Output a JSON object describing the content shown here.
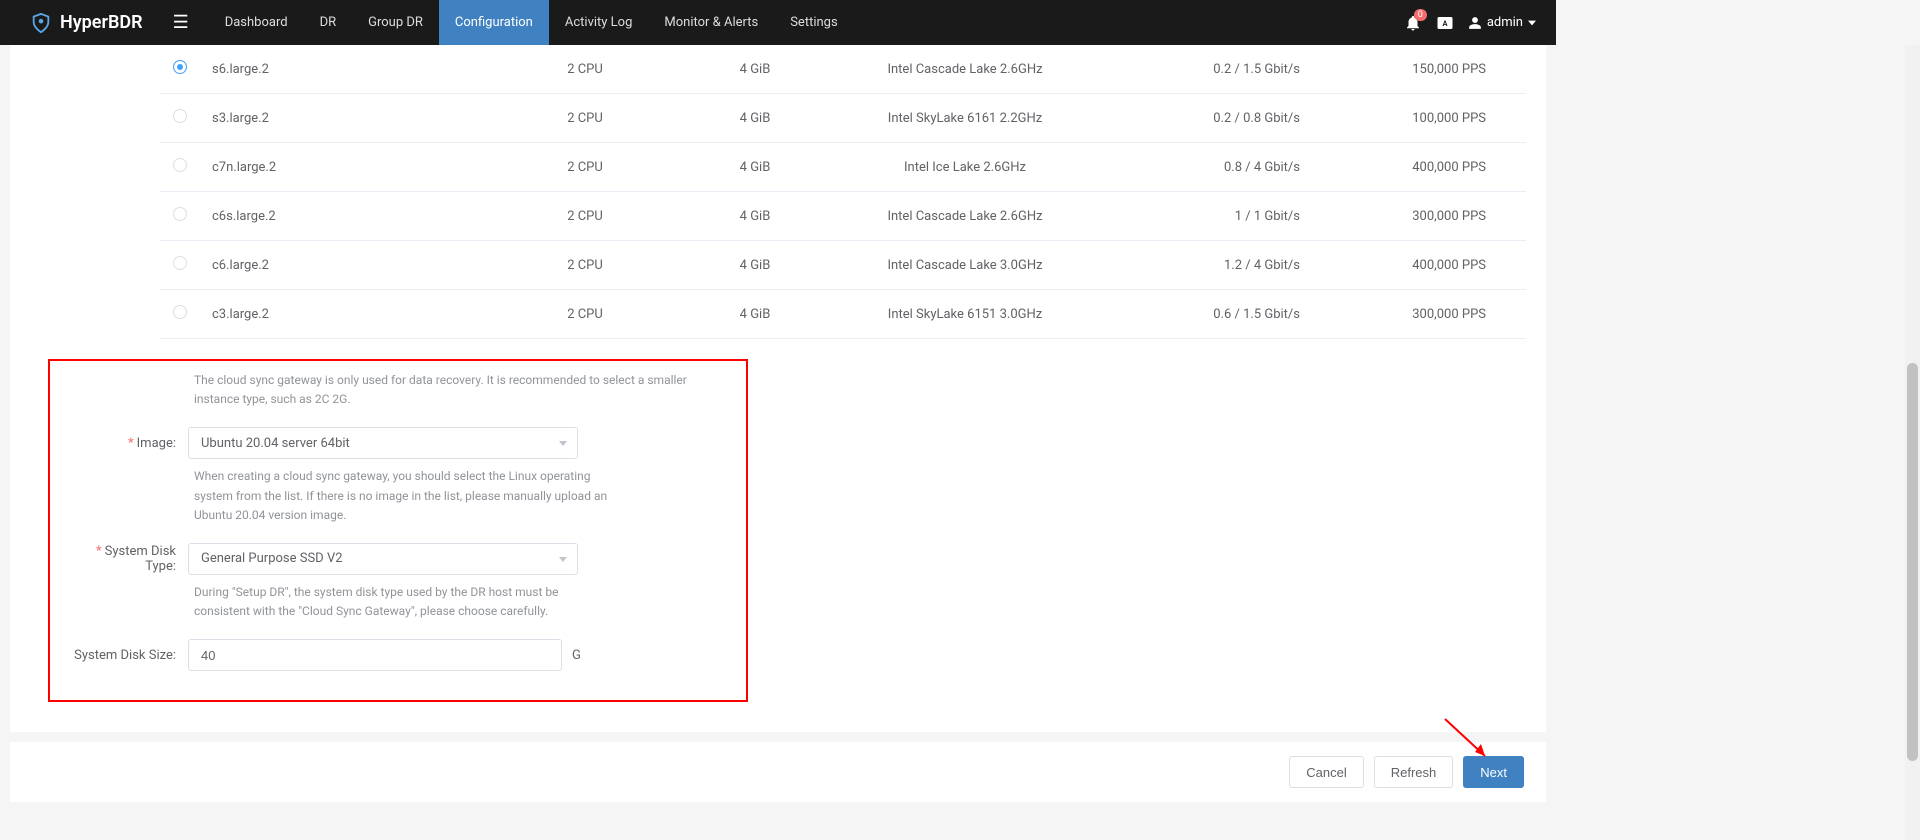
{
  "brand": {
    "name": "HyperBDR"
  },
  "nav": {
    "items": [
      "Dashboard",
      "DR",
      "Group DR",
      "Configuration",
      "Activity Log",
      "Monitor & Alerts",
      "Settings"
    ],
    "activeIndex": 3
  },
  "topbarRight": {
    "notificationCount": "0",
    "user": "admin"
  },
  "instanceTable": {
    "rows": [
      {
        "name": "s6.large.2",
        "cpu": "2 CPU",
        "mem": "4 GiB",
        "cpuModel": "Intel Cascade Lake 2.6GHz",
        "bandwidth": "0.2 / 1.5 Gbit/s",
        "pps": "150,000 PPS",
        "selected": true
      },
      {
        "name": "s3.large.2",
        "cpu": "2 CPU",
        "mem": "4 GiB",
        "cpuModel": "Intel SkyLake 6161 2.2GHz",
        "bandwidth": "0.2 / 0.8 Gbit/s",
        "pps": "100,000 PPS",
        "selected": false
      },
      {
        "name": "c7n.large.2",
        "cpu": "2 CPU",
        "mem": "4 GiB",
        "cpuModel": "Intel Ice Lake 2.6GHz",
        "bandwidth": "0.8 / 4 Gbit/s",
        "pps": "400,000 PPS",
        "selected": false
      },
      {
        "name": "c6s.large.2",
        "cpu": "2 CPU",
        "mem": "4 GiB",
        "cpuModel": "Intel Cascade Lake 2.6GHz",
        "bandwidth": "1 / 1 Gbit/s",
        "pps": "300,000 PPS",
        "selected": false
      },
      {
        "name": "c6.large.2",
        "cpu": "2 CPU",
        "mem": "4 GiB",
        "cpuModel": "Intel Cascade Lake 3.0GHz",
        "bandwidth": "1.2 / 4 Gbit/s",
        "pps": "400,000 PPS",
        "selected": false
      },
      {
        "name": "c3.large.2",
        "cpu": "2 CPU",
        "mem": "4 GiB",
        "cpuModel": "Intel SkyLake 6151 3.0GHz",
        "bandwidth": "0.6 / 1.5 Gbit/s",
        "pps": "300,000 PPS",
        "selected": false
      }
    ]
  },
  "form": {
    "gatewayHint": "The cloud sync gateway is only used for data recovery. It is recommended to select a smaller instance type, such as 2C 2G.",
    "image": {
      "label": "Image:",
      "value": "Ubuntu 20.04 server 64bit",
      "hint": "When creating a cloud sync gateway, you should select the Linux operating system from the list. If there is no image in the list, please manually upload an Ubuntu 20.04 version image."
    },
    "diskType": {
      "label": "System Disk Type:",
      "value": "General Purpose SSD V2",
      "hint": "During \"Setup DR\", the system disk type used by the DR host must be consistent with the \"Cloud Sync Gateway\", please choose carefully."
    },
    "diskSize": {
      "label": "System Disk Size:",
      "value": "40",
      "unit": "G"
    }
  },
  "footer": {
    "cancel": "Cancel",
    "refresh": "Refresh",
    "next": "Next"
  },
  "colors": {
    "primary": "#3f81c1",
    "danger": "#f56c6c"
  }
}
